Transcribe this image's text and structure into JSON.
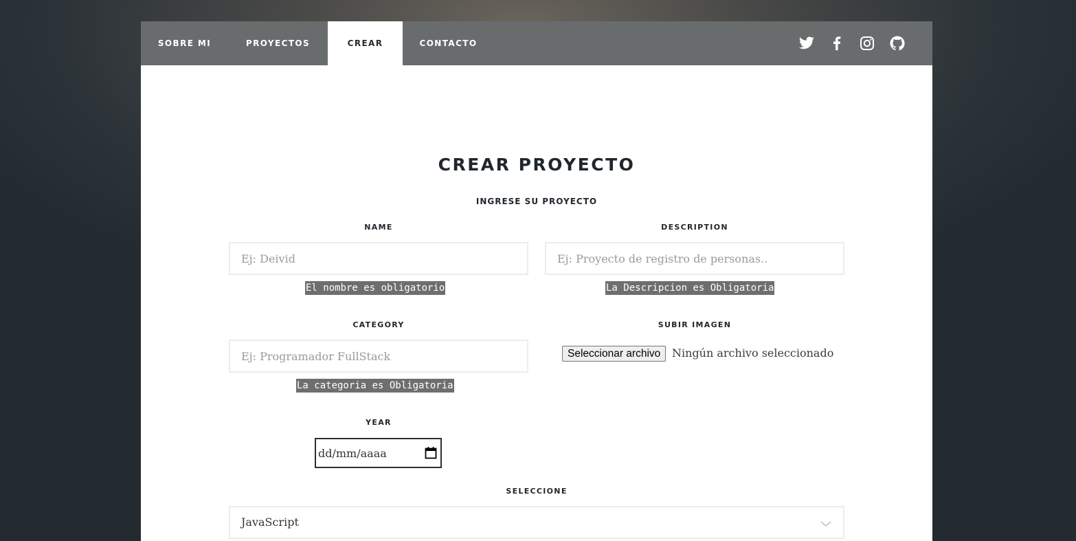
{
  "nav": {
    "items": [
      {
        "label": "SOBRE MI",
        "active": false
      },
      {
        "label": "PROYECTOS",
        "active": false
      },
      {
        "label": "CREAR",
        "active": true
      },
      {
        "label": "CONTACTO",
        "active": false
      }
    ],
    "social_icons": [
      "twitter-icon",
      "facebook-icon",
      "instagram-icon",
      "github-icon"
    ]
  },
  "form": {
    "title": "CREAR PROYECTO",
    "subtitle": "INGRESE SU PROYECTO",
    "name": {
      "label": "NAME",
      "value": "",
      "placeholder": "Ej: Deivid",
      "error": "El nombre es obligatorio"
    },
    "description": {
      "label": "DESCRIPTION",
      "value": "",
      "placeholder": "Ej: Proyecto de registro de personas..",
      "error": "La Descripcion es Obligatoria"
    },
    "category": {
      "label": "CATEGORY",
      "value": "",
      "placeholder": "Ej: Programador FullStack",
      "error": "La categoria es Obligatoria"
    },
    "image": {
      "label": "SUBIR IMAGEN",
      "button_label": "Seleccionar archivo",
      "status": "Ningún archivo seleccionado"
    },
    "year": {
      "label": "YEAR",
      "placeholder": "dd/mm/aaaa"
    },
    "select": {
      "label": "SELECCIONE",
      "selected": "JavaScript"
    }
  },
  "colors": {
    "nav_background": "#4e5254",
    "active_tab_text": "#262b30",
    "heading": "#1f262c",
    "error_background": "#6e6e6e",
    "input_border": "#ececec"
  }
}
